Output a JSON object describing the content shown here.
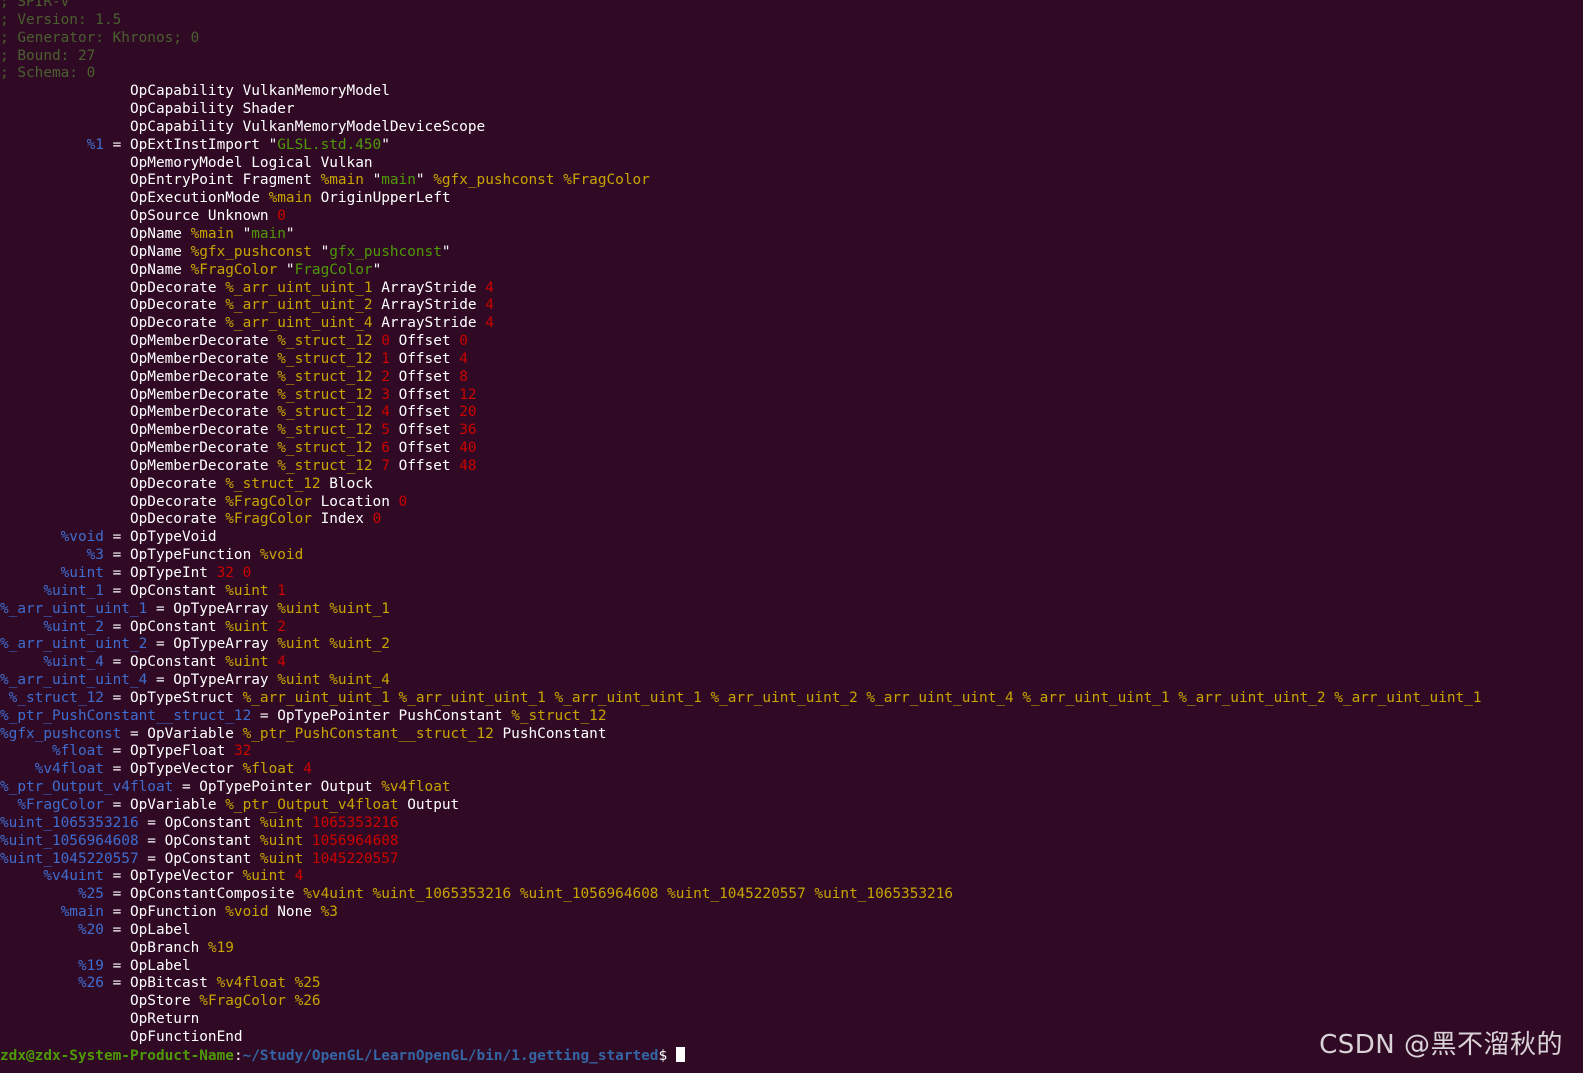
{
  "colors": {
    "background": "#300a24",
    "comment": "#4a5f2f",
    "id": "#3f6ccf",
    "ref": "#c7a400",
    "string": "#4e9a06",
    "number": "#cc0000",
    "plain": "#ffffff"
  },
  "terminal": {
    "lines": [
      [
        [
          "comment",
          "; SPIR-V"
        ]
      ],
      [
        [
          "comment",
          "; Version: 1.5"
        ]
      ],
      [
        [
          "comment",
          "; Generator: Khronos; 0"
        ]
      ],
      [
        [
          "comment",
          "; Bound: 27"
        ]
      ],
      [
        [
          "comment",
          "; Schema: 0"
        ]
      ],
      [
        [
          "plain",
          "               OpCapability VulkanMemoryModel"
        ]
      ],
      [
        [
          "plain",
          "               OpCapability Shader"
        ]
      ],
      [
        [
          "plain",
          "               OpCapability VulkanMemoryModelDeviceScope"
        ]
      ],
      [
        [
          "id",
          "          %1"
        ],
        [
          "plain",
          " = OpExtInstImport \""
        ],
        [
          "str",
          "GLSL.std.450"
        ],
        [
          "plain",
          "\""
        ]
      ],
      [
        [
          "plain",
          "               OpMemoryModel Logical Vulkan"
        ]
      ],
      [
        [
          "plain",
          "               OpEntryPoint Fragment "
        ],
        [
          "ref",
          "%main"
        ],
        [
          "plain",
          " \""
        ],
        [
          "str",
          "main"
        ],
        [
          "plain",
          "\" "
        ],
        [
          "ref",
          "%gfx_pushconst"
        ],
        [
          "plain",
          " "
        ],
        [
          "ref",
          "%FragColor"
        ]
      ],
      [
        [
          "plain",
          "               OpExecutionMode "
        ],
        [
          "ref",
          "%main"
        ],
        [
          "plain",
          " OriginUpperLeft"
        ]
      ],
      [
        [
          "plain",
          "               OpSource Unknown "
        ],
        [
          "num",
          "0"
        ]
      ],
      [
        [
          "plain",
          "               OpName "
        ],
        [
          "ref",
          "%main"
        ],
        [
          "plain",
          " \""
        ],
        [
          "str",
          "main"
        ],
        [
          "plain",
          "\""
        ]
      ],
      [
        [
          "plain",
          "               OpName "
        ],
        [
          "ref",
          "%gfx_pushconst"
        ],
        [
          "plain",
          " \""
        ],
        [
          "str",
          "gfx_pushconst"
        ],
        [
          "plain",
          "\""
        ]
      ],
      [
        [
          "plain",
          "               OpName "
        ],
        [
          "ref",
          "%FragColor"
        ],
        [
          "plain",
          " \""
        ],
        [
          "str",
          "FragColor"
        ],
        [
          "plain",
          "\""
        ]
      ],
      [
        [
          "plain",
          "               OpDecorate "
        ],
        [
          "ref",
          "%_arr_uint_uint_1"
        ],
        [
          "plain",
          " ArrayStride "
        ],
        [
          "num",
          "4"
        ]
      ],
      [
        [
          "plain",
          "               OpDecorate "
        ],
        [
          "ref",
          "%_arr_uint_uint_2"
        ],
        [
          "plain",
          " ArrayStride "
        ],
        [
          "num",
          "4"
        ]
      ],
      [
        [
          "plain",
          "               OpDecorate "
        ],
        [
          "ref",
          "%_arr_uint_uint_4"
        ],
        [
          "plain",
          " ArrayStride "
        ],
        [
          "num",
          "4"
        ]
      ],
      [
        [
          "plain",
          "               OpMemberDecorate "
        ],
        [
          "ref",
          "%_struct_12"
        ],
        [
          "plain",
          " "
        ],
        [
          "num",
          "0"
        ],
        [
          "plain",
          " Offset "
        ],
        [
          "num",
          "0"
        ]
      ],
      [
        [
          "plain",
          "               OpMemberDecorate "
        ],
        [
          "ref",
          "%_struct_12"
        ],
        [
          "plain",
          " "
        ],
        [
          "num",
          "1"
        ],
        [
          "plain",
          " Offset "
        ],
        [
          "num",
          "4"
        ]
      ],
      [
        [
          "plain",
          "               OpMemberDecorate "
        ],
        [
          "ref",
          "%_struct_12"
        ],
        [
          "plain",
          " "
        ],
        [
          "num",
          "2"
        ],
        [
          "plain",
          " Offset "
        ],
        [
          "num",
          "8"
        ]
      ],
      [
        [
          "plain",
          "               OpMemberDecorate "
        ],
        [
          "ref",
          "%_struct_12"
        ],
        [
          "plain",
          " "
        ],
        [
          "num",
          "3"
        ],
        [
          "plain",
          " Offset "
        ],
        [
          "num",
          "12"
        ]
      ],
      [
        [
          "plain",
          "               OpMemberDecorate "
        ],
        [
          "ref",
          "%_struct_12"
        ],
        [
          "plain",
          " "
        ],
        [
          "num",
          "4"
        ],
        [
          "plain",
          " Offset "
        ],
        [
          "num",
          "20"
        ]
      ],
      [
        [
          "plain",
          "               OpMemberDecorate "
        ],
        [
          "ref",
          "%_struct_12"
        ],
        [
          "plain",
          " "
        ],
        [
          "num",
          "5"
        ],
        [
          "plain",
          " Offset "
        ],
        [
          "num",
          "36"
        ]
      ],
      [
        [
          "plain",
          "               OpMemberDecorate "
        ],
        [
          "ref",
          "%_struct_12"
        ],
        [
          "plain",
          " "
        ],
        [
          "num",
          "6"
        ],
        [
          "plain",
          " Offset "
        ],
        [
          "num",
          "40"
        ]
      ],
      [
        [
          "plain",
          "               OpMemberDecorate "
        ],
        [
          "ref",
          "%_struct_12"
        ],
        [
          "plain",
          " "
        ],
        [
          "num",
          "7"
        ],
        [
          "plain",
          " Offset "
        ],
        [
          "num",
          "48"
        ]
      ],
      [
        [
          "plain",
          "               OpDecorate "
        ],
        [
          "ref",
          "%_struct_12"
        ],
        [
          "plain",
          " Block"
        ]
      ],
      [
        [
          "plain",
          "               OpDecorate "
        ],
        [
          "ref",
          "%FragColor"
        ],
        [
          "plain",
          " Location "
        ],
        [
          "num",
          "0"
        ]
      ],
      [
        [
          "plain",
          "               OpDecorate "
        ],
        [
          "ref",
          "%FragColor"
        ],
        [
          "plain",
          " Index "
        ],
        [
          "num",
          "0"
        ]
      ],
      [
        [
          "id",
          "       %void"
        ],
        [
          "plain",
          " = OpTypeVoid"
        ]
      ],
      [
        [
          "id",
          "          %3"
        ],
        [
          "plain",
          " = OpTypeFunction "
        ],
        [
          "ref",
          "%void"
        ]
      ],
      [
        [
          "id",
          "       %uint"
        ],
        [
          "plain",
          " = OpTypeInt "
        ],
        [
          "num",
          "32"
        ],
        [
          "plain",
          " "
        ],
        [
          "num",
          "0"
        ]
      ],
      [
        [
          "id",
          "     %uint_1"
        ],
        [
          "plain",
          " = OpConstant "
        ],
        [
          "ref",
          "%uint"
        ],
        [
          "plain",
          " "
        ],
        [
          "num",
          "1"
        ]
      ],
      [
        [
          "id",
          "%_arr_uint_uint_1"
        ],
        [
          "plain",
          " = OpTypeArray "
        ],
        [
          "ref",
          "%uint"
        ],
        [
          "plain",
          " "
        ],
        [
          "ref",
          "%uint_1"
        ]
      ],
      [
        [
          "id",
          "     %uint_2"
        ],
        [
          "plain",
          " = OpConstant "
        ],
        [
          "ref",
          "%uint"
        ],
        [
          "plain",
          " "
        ],
        [
          "num",
          "2"
        ]
      ],
      [
        [
          "id",
          "%_arr_uint_uint_2"
        ],
        [
          "plain",
          " = OpTypeArray "
        ],
        [
          "ref",
          "%uint"
        ],
        [
          "plain",
          " "
        ],
        [
          "ref",
          "%uint_2"
        ]
      ],
      [
        [
          "id",
          "     %uint_4"
        ],
        [
          "plain",
          " = OpConstant "
        ],
        [
          "ref",
          "%uint"
        ],
        [
          "plain",
          " "
        ],
        [
          "num",
          "4"
        ]
      ],
      [
        [
          "id",
          "%_arr_uint_uint_4"
        ],
        [
          "plain",
          " = OpTypeArray "
        ],
        [
          "ref",
          "%uint"
        ],
        [
          "plain",
          " "
        ],
        [
          "ref",
          "%uint_4"
        ]
      ],
      [
        [
          "id",
          " %_struct_12"
        ],
        [
          "plain",
          " = OpTypeStruct "
        ],
        [
          "ref",
          "%_arr_uint_uint_1 %_arr_uint_uint_1 %_arr_uint_uint_1 %_arr_uint_uint_2 %_arr_uint_uint_4 %_arr_uint_uint_1 %_arr_uint_uint_2 %_arr_uint_uint_1"
        ]
      ],
      [
        [
          "id",
          "%_ptr_PushConstant__struct_12"
        ],
        [
          "plain",
          " = OpTypePointer PushConstant "
        ],
        [
          "ref",
          "%_struct_12"
        ]
      ],
      [
        [
          "id",
          "%gfx_pushconst"
        ],
        [
          "plain",
          " = OpVariable "
        ],
        [
          "ref",
          "%_ptr_PushConstant__struct_12"
        ],
        [
          "plain",
          " PushConstant"
        ]
      ],
      [
        [
          "id",
          "      %float"
        ],
        [
          "plain",
          " = OpTypeFloat "
        ],
        [
          "num",
          "32"
        ]
      ],
      [
        [
          "id",
          "    %v4float"
        ],
        [
          "plain",
          " = OpTypeVector "
        ],
        [
          "ref",
          "%float"
        ],
        [
          "plain",
          " "
        ],
        [
          "num",
          "4"
        ]
      ],
      [
        [
          "id",
          "%_ptr_Output_v4float"
        ],
        [
          "plain",
          " = OpTypePointer Output "
        ],
        [
          "ref",
          "%v4float"
        ]
      ],
      [
        [
          "id",
          "  %FragColor"
        ],
        [
          "plain",
          " = OpVariable "
        ],
        [
          "ref",
          "%_ptr_Output_v4float"
        ],
        [
          "plain",
          " Output"
        ]
      ],
      [
        [
          "id",
          "%uint_1065353216"
        ],
        [
          "plain",
          " = OpConstant "
        ],
        [
          "ref",
          "%uint"
        ],
        [
          "plain",
          " "
        ],
        [
          "num",
          "1065353216"
        ]
      ],
      [
        [
          "id",
          "%uint_1056964608"
        ],
        [
          "plain",
          " = OpConstant "
        ],
        [
          "ref",
          "%uint"
        ],
        [
          "plain",
          " "
        ],
        [
          "num",
          "1056964608"
        ]
      ],
      [
        [
          "id",
          "%uint_1045220557"
        ],
        [
          "plain",
          " = OpConstant "
        ],
        [
          "ref",
          "%uint"
        ],
        [
          "plain",
          " "
        ],
        [
          "num",
          "1045220557"
        ]
      ],
      [
        [
          "id",
          "     %v4uint"
        ],
        [
          "plain",
          " = OpTypeVector "
        ],
        [
          "ref",
          "%uint"
        ],
        [
          "plain",
          " "
        ],
        [
          "num",
          "4"
        ]
      ],
      [
        [
          "id",
          "         %25"
        ],
        [
          "plain",
          " = OpConstantComposite "
        ],
        [
          "ref",
          "%v4uint %uint_1065353216 %uint_1056964608 %uint_1045220557 %uint_1065353216"
        ]
      ],
      [
        [
          "id",
          "       %main"
        ],
        [
          "plain",
          " = OpFunction "
        ],
        [
          "ref",
          "%void"
        ],
        [
          "plain",
          " None "
        ],
        [
          "ref",
          "%3"
        ]
      ],
      [
        [
          "id",
          "         %20"
        ],
        [
          "plain",
          " = OpLabel"
        ]
      ],
      [
        [
          "plain",
          "               OpBranch "
        ],
        [
          "ref",
          "%19"
        ]
      ],
      [
        [
          "id",
          "         %19"
        ],
        [
          "plain",
          " = OpLabel"
        ]
      ],
      [
        [
          "id",
          "         %26"
        ],
        [
          "plain",
          " = OpBitcast "
        ],
        [
          "ref",
          "%v4float"
        ],
        [
          "plain",
          " "
        ],
        [
          "ref",
          "%25"
        ]
      ],
      [
        [
          "plain",
          "               OpStore "
        ],
        [
          "ref",
          "%FragColor"
        ],
        [
          "plain",
          " "
        ],
        [
          "ref",
          "%26"
        ]
      ],
      [
        [
          "plain",
          "               OpReturn"
        ]
      ],
      [
        [
          "plain",
          "               OpFunctionEnd"
        ]
      ]
    ],
    "prompt": {
      "user": "zdx@zdx-System-Product-Name",
      "separator": ":",
      "path": "~/Study/OpenGL/LearnOpenGL/bin/1.getting_started",
      "symbol": "$ "
    }
  },
  "watermark": "CSDN @黑不溜秋的"
}
